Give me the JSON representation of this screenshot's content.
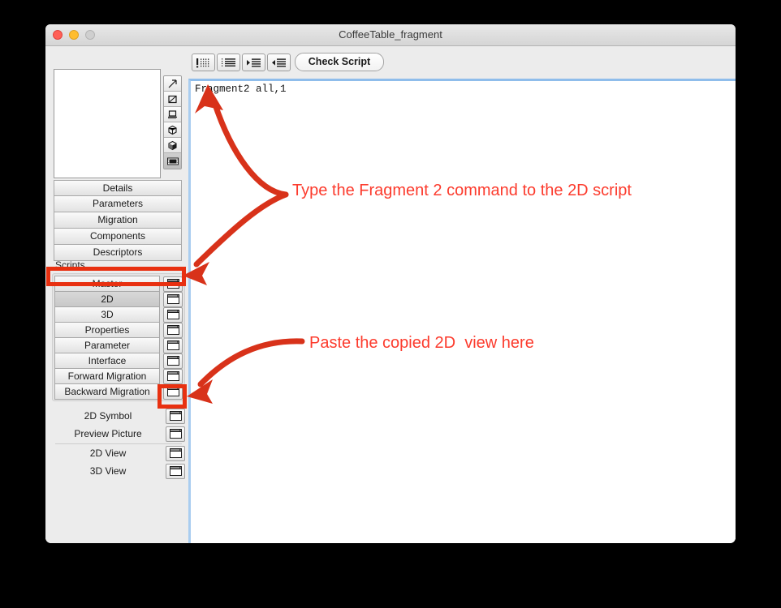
{
  "window": {
    "title": "CoffeeTable_fragment",
    "controls": {
      "close": "close-button",
      "minimize": "minimize-button",
      "zoom": "zoom-button"
    }
  },
  "left_panel": {
    "preview": {
      "name": "preview-thumbnail",
      "content": ""
    },
    "vertical_tools": [
      {
        "icon": "line-tool-icon",
        "active": false
      },
      {
        "icon": "rectangle-tool-icon",
        "active": false
      },
      {
        "icon": "plan-view-icon",
        "active": false
      },
      {
        "icon": "wireframe-cube-icon",
        "active": false
      },
      {
        "icon": "solid-cube-icon",
        "active": false
      },
      {
        "icon": "filmstrip-icon",
        "active": true
      }
    ],
    "buttons": [
      {
        "label": "Details"
      },
      {
        "label": "Parameters"
      },
      {
        "label": "Migration"
      },
      {
        "label": "Components"
      },
      {
        "label": "Descriptors"
      }
    ],
    "scripts_group_label": "Scripts",
    "script_rows": [
      {
        "label": "Master",
        "selected": false,
        "icon": "window-icon"
      },
      {
        "label": "2D",
        "selected": true,
        "icon": "window-icon"
      },
      {
        "label": "3D",
        "selected": false,
        "icon": "window-icon"
      },
      {
        "label": "Properties",
        "selected": false,
        "icon": "window-icon"
      },
      {
        "label": "Parameter",
        "selected": false,
        "icon": "window-icon"
      },
      {
        "label": "Interface",
        "selected": false,
        "icon": "window-icon"
      },
      {
        "label": "Forward Migration",
        "selected": false,
        "icon": "window-icon"
      },
      {
        "label": "Backward Migration",
        "selected": false,
        "icon": "window-icon"
      }
    ],
    "symbol_rows": [
      {
        "label": "2D Symbol",
        "icon": "window-icon"
      },
      {
        "label": "Preview Picture",
        "icon": "window-icon"
      }
    ],
    "view_rows": [
      {
        "label": "2D View",
        "icon": "window-icon"
      },
      {
        "label": "3D View",
        "icon": "window-icon"
      }
    ]
  },
  "toolbar": {
    "tools": [
      {
        "icon": "show-invisible-characters-icon"
      },
      {
        "icon": "line-numbers-icon"
      },
      {
        "icon": "indent-right-icon"
      },
      {
        "icon": "indent-left-icon"
      }
    ],
    "check_script_label": "Check Script"
  },
  "editor": {
    "script_text": "Fragment2 all,1"
  },
  "annotations": [
    {
      "text": "Type the Fragment 2 command to the 2D script",
      "color": "#fc3b2d"
    },
    {
      "text": "Paste the copied 2D  view here",
      "color": "#fc3b2d"
    }
  ],
  "highlights": {
    "script_2d_row": "highlight-2d-script-row",
    "symbol_2d_button": "highlight-2d-symbol-button",
    "color": "#e83010"
  }
}
